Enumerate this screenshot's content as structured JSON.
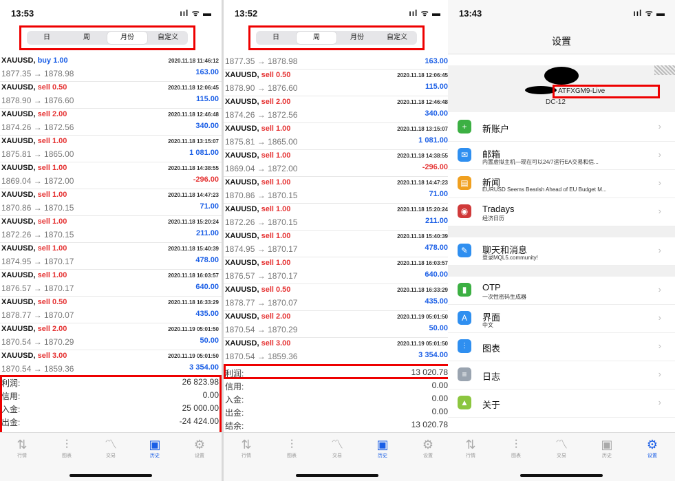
{
  "screen1": {
    "time": "13:53",
    "status_icons": "ııl ᯤ ▬",
    "segments": [
      "日",
      "周",
      "月份",
      "自定义"
    ],
    "active_segment": 2,
    "trades": [
      {
        "symbol": "XAUUSD,",
        "dir": "buy 1.00",
        "buy": true,
        "prices": "1877.35 → 1878.98",
        "time": "2020.11.18 11:46:12",
        "profit": "163.00",
        "neg": false
      },
      {
        "symbol": "XAUUSD,",
        "dir": "sell 0.50",
        "buy": false,
        "prices": "1878.90 → 1876.60",
        "time": "2020.11.18 12:06:45",
        "profit": "115.00",
        "neg": false
      },
      {
        "symbol": "XAUUSD,",
        "dir": "sell 2.00",
        "buy": false,
        "prices": "1874.26 → 1872.56",
        "time": "2020.11.18 12:46:48",
        "profit": "340.00",
        "neg": false
      },
      {
        "symbol": "XAUUSD,",
        "dir": "sell 1.00",
        "buy": false,
        "prices": "1875.81 → 1865.00",
        "time": "2020.11.18 13:15:07",
        "profit": "1 081.00",
        "neg": false
      },
      {
        "symbol": "XAUUSD,",
        "dir": "sell 1.00",
        "buy": false,
        "prices": "1869.04 → 1872.00",
        "time": "2020.11.18 14:38:55",
        "profit": "-296.00",
        "neg": true
      },
      {
        "symbol": "XAUUSD,",
        "dir": "sell 1.00",
        "buy": false,
        "prices": "1870.86 → 1870.15",
        "time": "2020.11.18 14:47:23",
        "profit": "71.00",
        "neg": false
      },
      {
        "symbol": "XAUUSD,",
        "dir": "sell 1.00",
        "buy": false,
        "prices": "1872.26 → 1870.15",
        "time": "2020.11.18 15:20:24",
        "profit": "211.00",
        "neg": false
      },
      {
        "symbol": "XAUUSD,",
        "dir": "sell 1.00",
        "buy": false,
        "prices": "1874.95 → 1870.17",
        "time": "2020.11.18 15:40:39",
        "profit": "478.00",
        "neg": false
      },
      {
        "symbol": "XAUUSD,",
        "dir": "sell 1.00",
        "buy": false,
        "prices": "1876.57 → 1870.17",
        "time": "2020.11.18 16:03:57",
        "profit": "640.00",
        "neg": false
      },
      {
        "symbol": "XAUUSD,",
        "dir": "sell 0.50",
        "buy": false,
        "prices": "1878.77 → 1870.07",
        "time": "2020.11.18 16:33:29",
        "profit": "435.00",
        "neg": false
      },
      {
        "symbol": "XAUUSD,",
        "dir": "sell 2.00",
        "buy": false,
        "prices": "1870.54 → 1870.29",
        "time": "2020.11.19 05:01:50",
        "profit": "50.00",
        "neg": false
      },
      {
        "symbol": "XAUUSD,",
        "dir": "sell 3.00",
        "buy": false,
        "prices": "1870.54 → 1859.36",
        "time": "2020.11.19 05:01:50",
        "profit": "3 354.00",
        "neg": false
      }
    ],
    "summary": [
      {
        "k": "利润:",
        "v": "26 823.98"
      },
      {
        "k": "信用:",
        "v": "0.00"
      },
      {
        "k": "入金:",
        "v": "25 000.00"
      },
      {
        "k": "出金:",
        "v": "-24 424.00"
      }
    ]
  },
  "screen2": {
    "time": "13:52",
    "status_icons": "ııl ᯤ ▬",
    "segments": [
      "日",
      "周",
      "月份",
      "自定义"
    ],
    "active_segment": 1,
    "first_prices": "1877.35 → 1878.98",
    "first_profit": "163.00",
    "trades": [
      {
        "symbol": "XAUUSD,",
        "dir": "sell 0.50",
        "buy": false,
        "prices": "1878.90 → 1876.60",
        "time": "2020.11.18 12:06:45",
        "profit": "115.00",
        "neg": false
      },
      {
        "symbol": "XAUUSD,",
        "dir": "sell 2.00",
        "buy": false,
        "prices": "1874.26 → 1872.56",
        "time": "2020.11.18 12:46:48",
        "profit": "340.00",
        "neg": false
      },
      {
        "symbol": "XAUUSD,",
        "dir": "sell 1.00",
        "buy": false,
        "prices": "1875.81 → 1865.00",
        "time": "2020.11.18 13:15:07",
        "profit": "1 081.00",
        "neg": false
      },
      {
        "symbol": "XAUUSD,",
        "dir": "sell 1.00",
        "buy": false,
        "prices": "1869.04 → 1872.00",
        "time": "2020.11.18 14:38:55",
        "profit": "-296.00",
        "neg": true
      },
      {
        "symbol": "XAUUSD,",
        "dir": "sell 1.00",
        "buy": false,
        "prices": "1870.86 → 1870.15",
        "time": "2020.11.18 14:47:23",
        "profit": "71.00",
        "neg": false
      },
      {
        "symbol": "XAUUSD,",
        "dir": "sell 1.00",
        "buy": false,
        "prices": "1872.26 → 1870.15",
        "time": "2020.11.18 15:20:24",
        "profit": "211.00",
        "neg": false
      },
      {
        "symbol": "XAUUSD,",
        "dir": "sell 1.00",
        "buy": false,
        "prices": "1874.95 → 1870.17",
        "time": "2020.11.18 15:40:39",
        "profit": "478.00",
        "neg": false
      },
      {
        "symbol": "XAUUSD,",
        "dir": "sell 1.00",
        "buy": false,
        "prices": "1876.57 → 1870.17",
        "time": "2020.11.18 16:03:57",
        "profit": "640.00",
        "neg": false
      },
      {
        "symbol": "XAUUSD,",
        "dir": "sell 0.50",
        "buy": false,
        "prices": "1878.77 → 1870.07",
        "time": "2020.11.18 16:33:29",
        "profit": "435.00",
        "neg": false
      },
      {
        "symbol": "XAUUSD,",
        "dir": "sell 2.00",
        "buy": false,
        "prices": "1870.54 → 1870.29",
        "time": "2020.11.19 05:01:50",
        "profit": "50.00",
        "neg": false
      },
      {
        "symbol": "XAUUSD,",
        "dir": "sell 3.00",
        "buy": false,
        "prices": "1870.54 → 1859.36",
        "time": "2020.11.19 05:01:50",
        "profit": "3 354.00",
        "neg": false
      }
    ],
    "summary": [
      {
        "k": "利润:",
        "v": "13 020.78"
      },
      {
        "k": "信用:",
        "v": "0.00"
      },
      {
        "k": "入金:",
        "v": "0.00"
      },
      {
        "k": "出金:",
        "v": "0.00"
      },
      {
        "k": "结余:",
        "v": "13 020.78"
      }
    ]
  },
  "tabs": [
    {
      "label": "行情",
      "icon": "quotes-icon"
    },
    {
      "label": "图表",
      "icon": "chart-icon"
    },
    {
      "label": "交易",
      "icon": "trade-icon"
    },
    {
      "label": "历史",
      "icon": "history-icon"
    },
    {
      "label": "设置",
      "icon": "settings-icon"
    }
  ],
  "screen3": {
    "time": "13:43",
    "status_icons": "ııl ᯤ ▬",
    "title": "设置",
    "account_name": "ATFXGM9-Live",
    "server": "DC-12",
    "menu": [
      {
        "title": "新账户",
        "sub": "",
        "icon": "new-account-icon",
        "color": "#3cb043",
        "glyph": "+"
      },
      {
        "title": "邮箱",
        "sub": "内置虚拟主机—现在可以24/7运行EA交易和信...",
        "icon": "mail-icon",
        "color": "#2f8ff0",
        "glyph": "✉"
      },
      {
        "title": "新闻",
        "sub": "EURUSD Seems Bearish Ahead of EU Budget M...",
        "icon": "news-icon",
        "color": "#f0a020",
        "glyph": "▤"
      },
      {
        "title": "Tradays",
        "sub": "经济日历",
        "icon": "tradays-icon",
        "color": "#d03a3a",
        "glyph": "◉"
      },
      {
        "title": "聊天和消息",
        "sub": "登录MQL5.community!",
        "icon": "chat-icon",
        "color": "#2f8ff0",
        "glyph": "✎"
      },
      {
        "title": "OTP",
        "sub": "一次性密码生成器",
        "icon": "otp-icon",
        "color": "#3cb043",
        "glyph": "▮"
      },
      {
        "title": "界面",
        "sub": "中文",
        "icon": "language-icon",
        "color": "#2f8ff0",
        "glyph": "A"
      },
      {
        "title": "图表",
        "sub": "",
        "icon": "charts-icon",
        "color": "#2f8ff0",
        "glyph": "⫶"
      },
      {
        "title": "日志",
        "sub": "",
        "icon": "journal-icon",
        "color": "#9aa4b0",
        "glyph": "≡"
      },
      {
        "title": "关于",
        "sub": "",
        "icon": "about-icon",
        "color": "#8cc63f",
        "glyph": "▲"
      }
    ]
  }
}
